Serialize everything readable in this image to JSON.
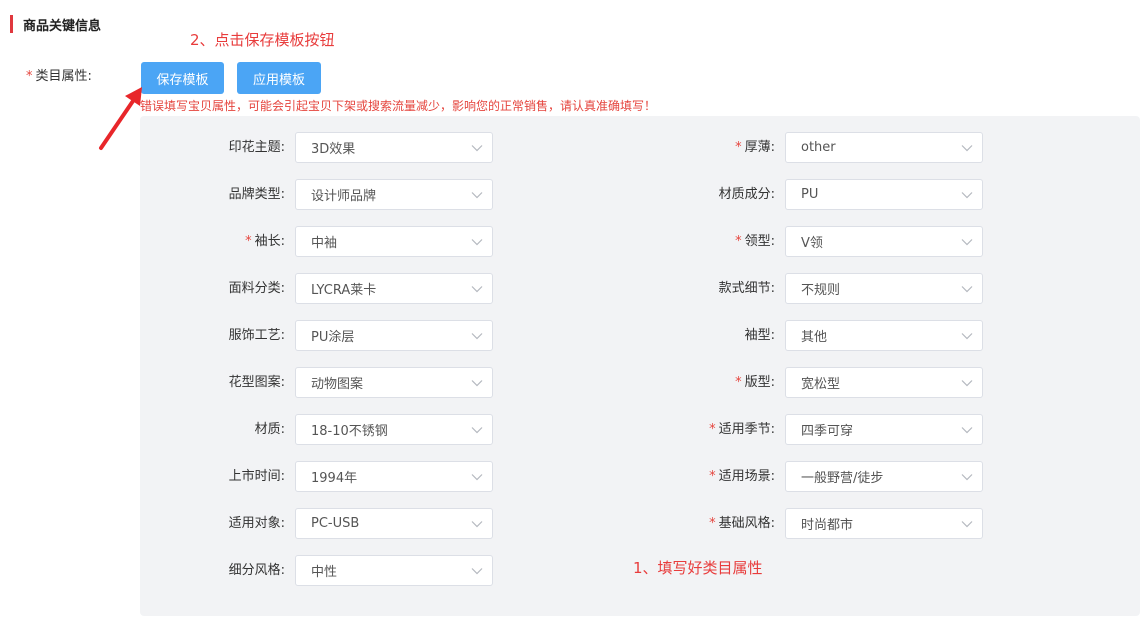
{
  "section": {
    "title": "商品关键信息"
  },
  "annotations": {
    "step2": "2、点击保存模板按钮",
    "step1": "1、填写好类目属性"
  },
  "category_field": {
    "required_mark": "*",
    "label": "类目属性:"
  },
  "buttons": {
    "save_template": "保存模板",
    "apply_template": "应用模板"
  },
  "warning": "错误填写宝贝属性，可能会引起宝贝下架或搜索流量减少，影响您的正常销售，请认真准确填写！",
  "colors": {
    "accent": "#4ba5f5",
    "danger": "#e5443d",
    "panel_bg": "#f2f3f5"
  },
  "left_fields": [
    {
      "label": "印花主题:",
      "required": false,
      "value": "3D效果"
    },
    {
      "label": "品牌类型:",
      "required": false,
      "value": "设计师品牌"
    },
    {
      "label": "袖长:",
      "required": true,
      "value": "中袖"
    },
    {
      "label": "面料分类:",
      "required": false,
      "value": "LYCRA莱卡"
    },
    {
      "label": "服饰工艺:",
      "required": false,
      "value": "PU涂层"
    },
    {
      "label": "花型图案:",
      "required": false,
      "value": "动物图案"
    },
    {
      "label": "材质:",
      "required": false,
      "value": "18-10不锈钢"
    },
    {
      "label": "上市时间:",
      "required": false,
      "value": "1994年"
    },
    {
      "label": "适用对象:",
      "required": false,
      "value": "PC-USB"
    },
    {
      "label": "细分风格:",
      "required": false,
      "value": "中性"
    }
  ],
  "right_fields": [
    {
      "label": "厚薄:",
      "required": true,
      "value": "other"
    },
    {
      "label": "材质成分:",
      "required": false,
      "value": "PU"
    },
    {
      "label": "领型:",
      "required": true,
      "value": "V领"
    },
    {
      "label": "款式细节:",
      "required": false,
      "value": "不规则"
    },
    {
      "label": "袖型:",
      "required": false,
      "value": "其他"
    },
    {
      "label": "版型:",
      "required": true,
      "value": "宽松型"
    },
    {
      "label": "适用季节:",
      "required": true,
      "value": "四季可穿"
    },
    {
      "label": "适用场景:",
      "required": true,
      "value": "一般野营/徒步"
    },
    {
      "label": "基础风格:",
      "required": true,
      "value": "时尚都市"
    }
  ]
}
